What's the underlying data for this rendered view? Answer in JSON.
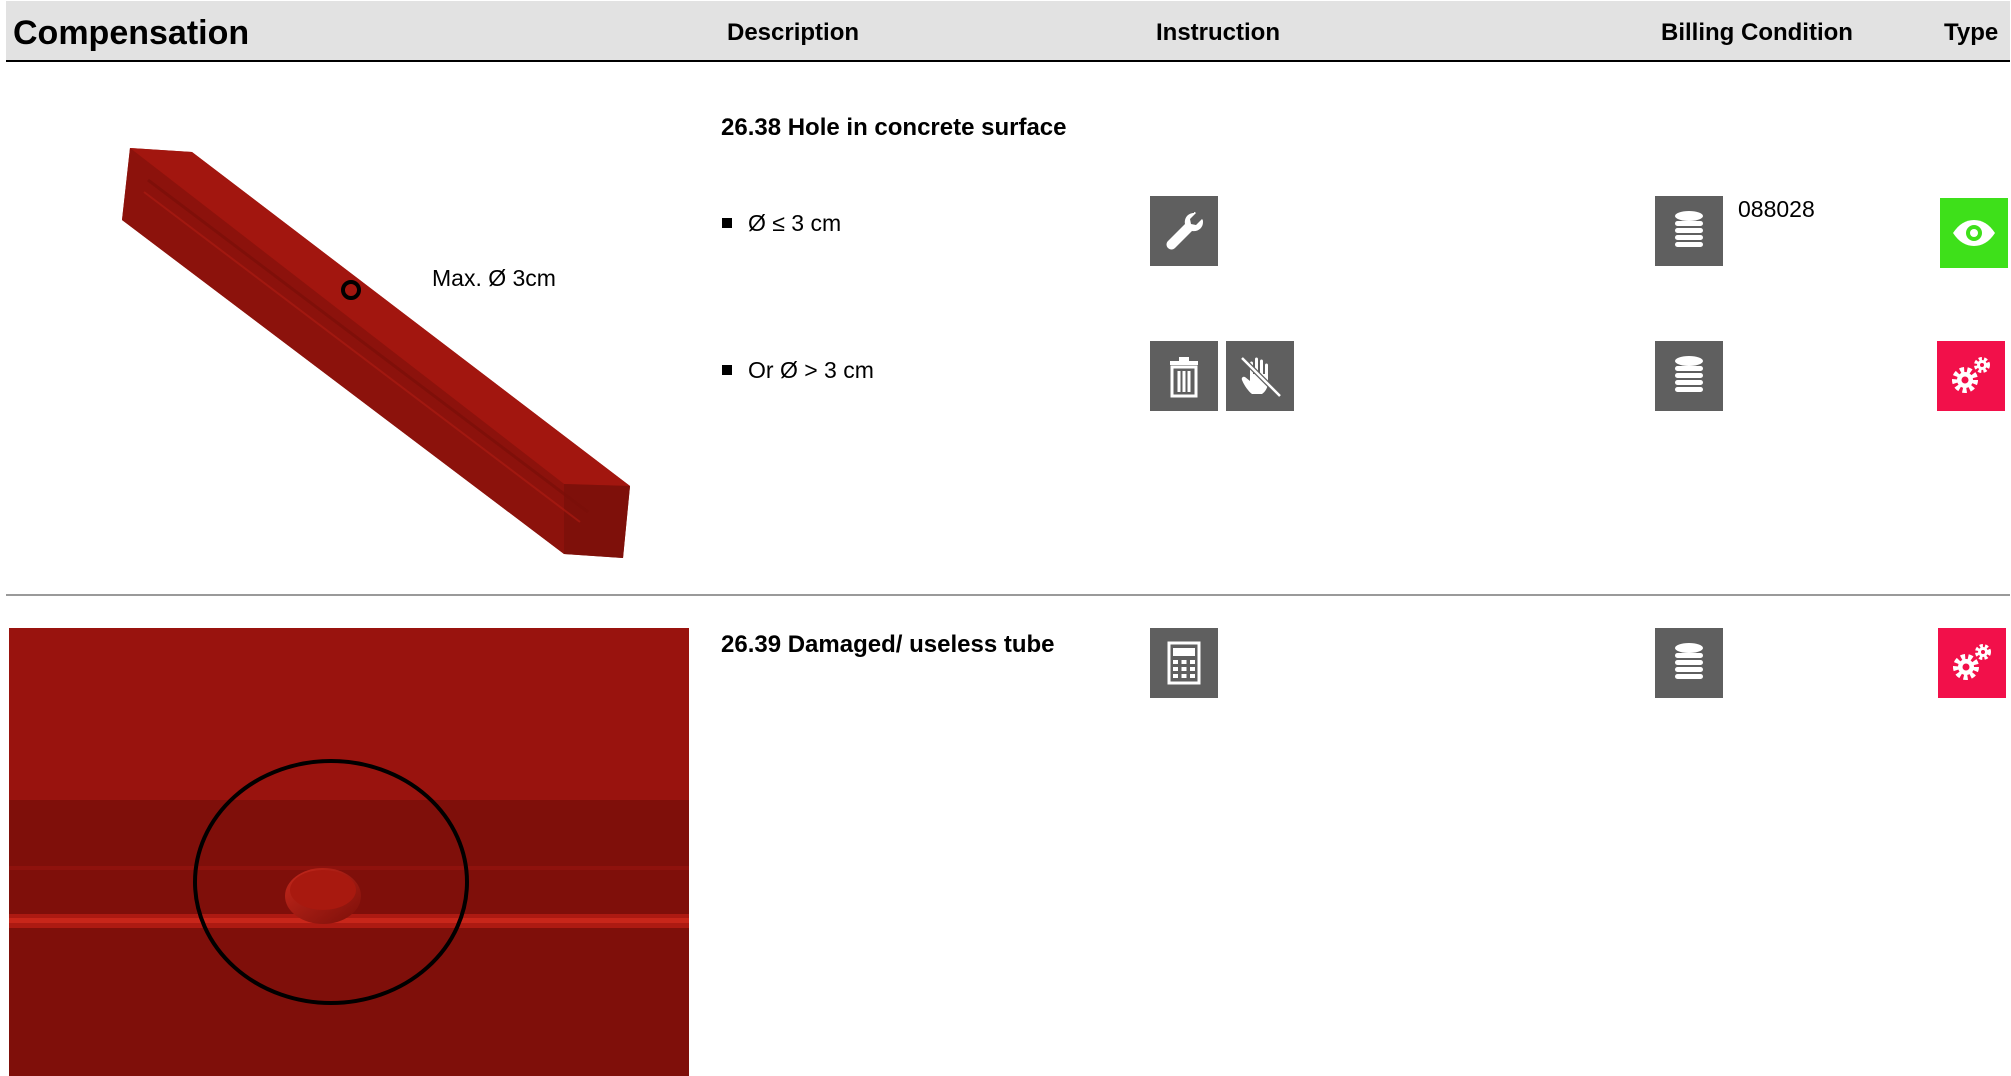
{
  "header": {
    "title": "Compensation",
    "columns": {
      "description": "Description",
      "instruction": "Instruction",
      "billing": "Billing Condition",
      "type": "Type"
    }
  },
  "sections": [
    {
      "title": "26.38 Hole in concrete surface",
      "image_label": "Max. Ø 3cm",
      "items": [
        {
          "text": "Ø ≤ 3 cm",
          "instruction_icons": [
            "wrench-icon"
          ],
          "billing_icon": "coin-stack-icon",
          "billing_code": "088028",
          "type_icon": "eye-icon",
          "type_color": "#3ee01a"
        },
        {
          "text": "Or Ø > 3 cm",
          "instruction_icons": [
            "trash-icon",
            "no-touch-hand-icon"
          ],
          "billing_icon": "coin-stack-icon",
          "billing_code": "",
          "type_icon": "gears-icon",
          "type_color": "#f2104a"
        }
      ]
    },
    {
      "title": "26.39 Damaged/ useless tube",
      "instruction_icons": [
        "calculator-icon"
      ],
      "billing_icon": "coin-stack-icon",
      "type_icon": "gears-icon",
      "type_color": "#f2104a"
    }
  ],
  "colors": {
    "header_bg": "#e2e2e2",
    "icon_bg": "#5f5f5f",
    "concrete_red": "#9b1510"
  }
}
